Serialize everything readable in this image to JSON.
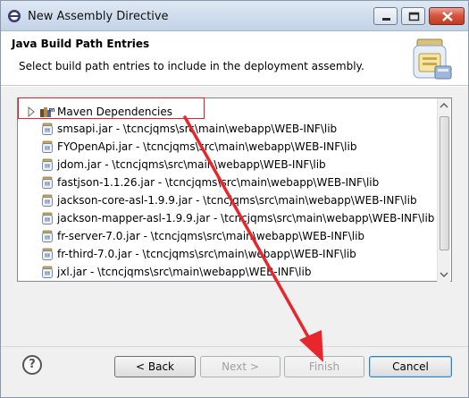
{
  "window": {
    "title": "New Assembly Directive",
    "buttons": {
      "minimize": "minimize",
      "maximize": "maximize",
      "close": "close"
    }
  },
  "header": {
    "title": "Java Build Path Entries",
    "description": "Select build path entries to include in the deployment assembly."
  },
  "entries": [
    {
      "label": "Maven Dependencies",
      "icon": "library-icon",
      "expandable": true
    },
    {
      "label": "smsapi.jar - \\tcncjqms\\src\\main\\webapp\\WEB-INF\\lib",
      "icon": "jar-icon"
    },
    {
      "label": "FYOpenApi.jar - \\tcncjqms\\src\\main\\webapp\\WEB-INF\\lib",
      "icon": "jar-icon"
    },
    {
      "label": "jdom.jar - \\tcncjqms\\src\\main\\webapp\\WEB-INF\\lib",
      "icon": "jar-icon"
    },
    {
      "label": "fastjson-1.1.26.jar - \\tcncjqms\\src\\main\\webapp\\WEB-INF\\lib",
      "icon": "jar-icon"
    },
    {
      "label": "jackson-core-asl-1.9.9.jar - \\tcncjqms\\src\\main\\webapp\\WEB-INF\\lib",
      "icon": "jar-icon"
    },
    {
      "label": "jackson-mapper-asl-1.9.9.jar - \\tcncjqms\\src\\main\\webapp\\WEB-INF\\lib",
      "icon": "jar-icon"
    },
    {
      "label": "fr-server-7.0.jar - \\tcncjqms\\src\\main\\webapp\\WEB-INF\\lib",
      "icon": "jar-icon"
    },
    {
      "label": "fr-third-7.0.jar - \\tcncjqms\\src\\main\\webapp\\WEB-INF\\lib",
      "icon": "jar-icon"
    },
    {
      "label": "jxl.jar - \\tcncjqms\\src\\main\\webapp\\WEB-INF\\lib",
      "icon": "jar-icon"
    }
  ],
  "footer": {
    "help": "?",
    "back": "< Back",
    "next": "Next >",
    "finish": "Finish",
    "cancel": "Cancel"
  },
  "colors": {
    "highlight": "#e0222a",
    "arrow": "#e8262c"
  }
}
